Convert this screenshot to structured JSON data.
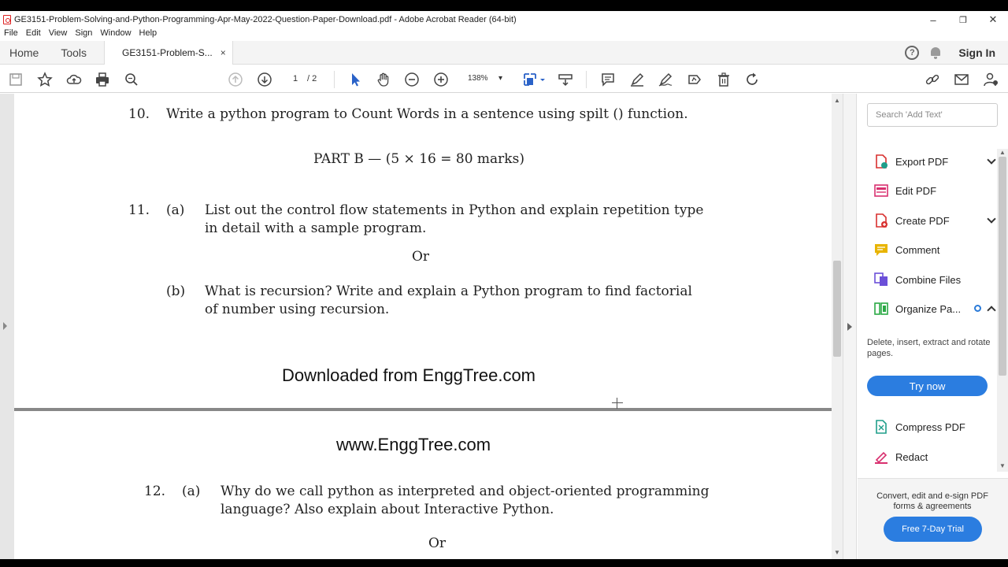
{
  "window": {
    "title": "GE3151-Problem-Solving-and-Python-Programming-Apr-May-2022-Question-Paper-Download.pdf - Adobe Acrobat Reader (64-bit)",
    "minimize": "–",
    "maximize": "❐",
    "close": "✕"
  },
  "menu": [
    "File",
    "Edit",
    "View",
    "Sign",
    "Window",
    "Help"
  ],
  "tabs": {
    "home": "Home",
    "tools": "Tools",
    "document": "GE3151-Problem-S...",
    "close": "×",
    "signin": "Sign In",
    "help": "?"
  },
  "toolbar": {
    "page_current": "1",
    "page_total": "/ 2",
    "zoom": "138%",
    "zoom_caret": "▾"
  },
  "document": {
    "q10_num": "10.",
    "q10_text": "Write a python program to Count Words in a sentence using spilt () function.",
    "part_b": "PART B — (5 × 16 = 80 marks)",
    "q11_num": "11.",
    "q11a_label": "(a)",
    "q11a_line1": "List out the control flow statements in Python and explain repetition type",
    "q11a_line2": "in detail with a sample program.",
    "or1": "Or",
    "q11b_label": "(b)",
    "q11b_line1": "What is recursion? Write and explain a Python program to find factorial",
    "q11b_line2": "of number using recursion.",
    "footer": "Downloaded from EnggTree.com",
    "header2": "www.EnggTree.com",
    "q12_num": "12.",
    "q12a_label": "(a)",
    "q12a_line1": "Why do we call python as interpreted and object-oriented programming",
    "q12a_line2": "language? Also explain about Interactive Python.",
    "or2": "Or"
  },
  "panel": {
    "search_placeholder": "Search 'Add Text'",
    "tools": [
      {
        "label": "Export PDF",
        "color": "#d8302f"
      },
      {
        "label": "Edit PDF",
        "color": "#d8306f"
      },
      {
        "label": "Create PDF",
        "color": "#d8302f"
      },
      {
        "label": "Comment",
        "color": "#e8b400"
      },
      {
        "label": "Combine Files",
        "color": "#6b4fd8"
      },
      {
        "label": "Organize Pa...",
        "color": "#2aa844"
      },
      {
        "label": "Compress PDF",
        "color": "#1f9e8a"
      },
      {
        "label": "Redact",
        "color": "#d8306f"
      }
    ],
    "organize_desc": "Delete, insert, extract and rotate pages.",
    "try_now": "Try now",
    "footer_text": "Convert, edit and e-sign PDF forms & agreements",
    "trial": "Free 7-Day Trial"
  }
}
